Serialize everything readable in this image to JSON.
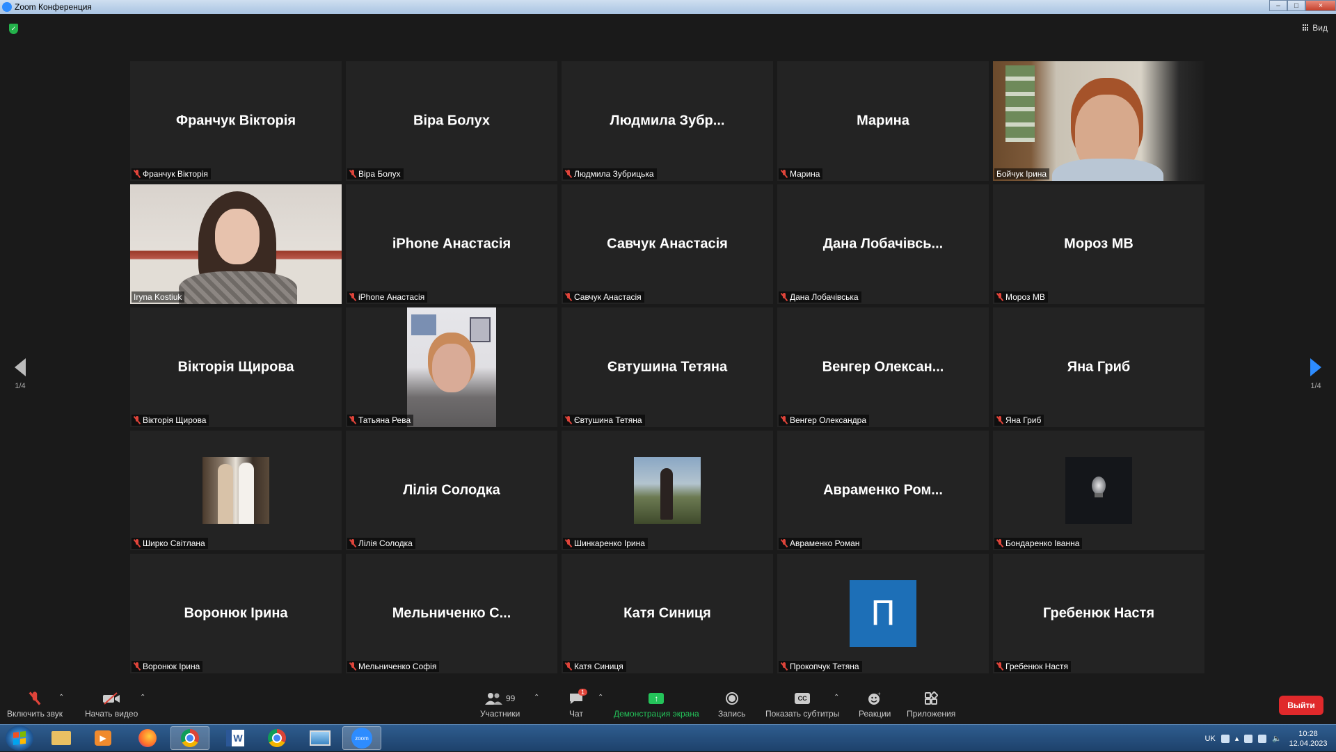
{
  "window": {
    "title": "Zoom Конференция",
    "min": "–",
    "max": "□",
    "close": "×"
  },
  "top": {
    "view_label": "Вид"
  },
  "pagination": {
    "left_label": "1/4",
    "right_label": "1/4"
  },
  "tiles": [
    {
      "display": "Франчук Вікторія",
      "label": "Франчук Вікторія"
    },
    {
      "display": "Віра Болух",
      "label": "Віра Болух"
    },
    {
      "display": "Людмила  Зубр...",
      "label": "Людмила Зубрицька"
    },
    {
      "display": "Марина",
      "label": "Марина"
    },
    {
      "display": "",
      "label": "Бойчук Ірина"
    },
    {
      "display": "",
      "label": "Iryna Kostiuk"
    },
    {
      "display": "iPhone Анастасія",
      "label": "iPhone Анастасія"
    },
    {
      "display": "Савчук Анастасія",
      "label": "Савчук Анастасія"
    },
    {
      "display": "Дана  Лобачівсь...",
      "label": "Дана Лобачівська"
    },
    {
      "display": "Мороз МВ",
      "label": "Мороз МВ"
    },
    {
      "display": "Вікторія Щирова",
      "label": "Вікторія Щирова"
    },
    {
      "display": "",
      "label": "Татьяна Рева"
    },
    {
      "display": "Євтушина Тетяна",
      "label": "Євтушина Тетяна"
    },
    {
      "display": "Венгер  Олексан...",
      "label": "Венгер Олександра"
    },
    {
      "display": "Яна Гриб",
      "label": "Яна Гриб"
    },
    {
      "display": "",
      "label": "Ширко Світлана"
    },
    {
      "display": "Лілія Солодка",
      "label": "Лілія Солодка"
    },
    {
      "display": "",
      "label": "Шинкаренко Ірина"
    },
    {
      "display": "Авраменко  Ром...",
      "label": "Авраменко Роман"
    },
    {
      "display": "",
      "label": "Бондаренко Іванна"
    },
    {
      "display": "Воронюк Ірина",
      "label": "Воронюк Ірина"
    },
    {
      "display": "Мельниченко  С...",
      "label": "Мельниченко Софія"
    },
    {
      "display": "Катя Синиця",
      "label": "Катя Синиця"
    },
    {
      "display": "П",
      "label": "Прокопчук Тетяна"
    },
    {
      "display": "Гребенюк Настя",
      "label": "Гребенюк Настя"
    }
  ],
  "toolbar": {
    "unmute": "Включить звук",
    "start_video": "Начать видео",
    "participants": "Участники",
    "participants_count": "99",
    "chat": "Чат",
    "chat_badge": "1",
    "share": "Демонстрация экрана",
    "record": "Запись",
    "captions": "Показать субтитры",
    "captions_icon": "CC",
    "reactions": "Реакции",
    "apps": "Приложения",
    "leave": "Выйти"
  },
  "taskbar": {
    "word_icon": "W",
    "zoom_icon": "zoom",
    "lang": "UK",
    "time": "10:28",
    "date": "12.04.2023"
  },
  "colors": {
    "accent": "#2d8cff",
    "share_green": "#24c45a",
    "leave_red": "#e0292b",
    "active_speaker": "#d7d236"
  }
}
